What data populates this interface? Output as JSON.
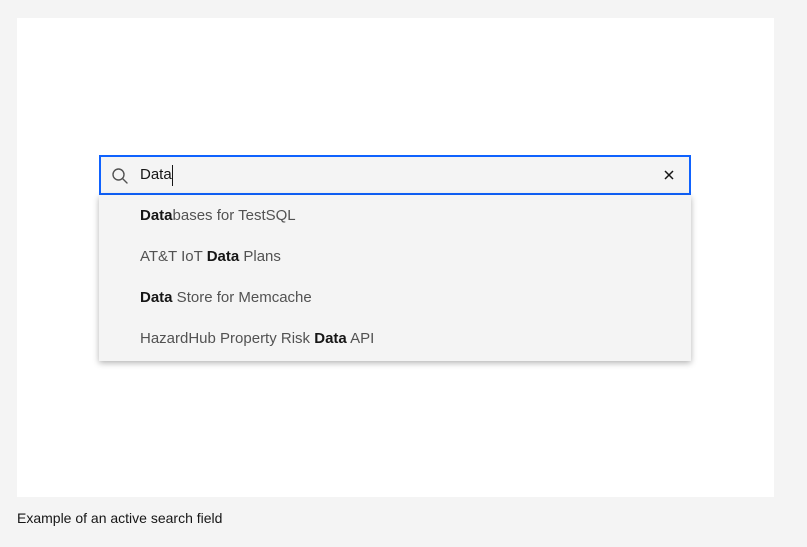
{
  "search": {
    "value": "Data",
    "placeholder": ""
  },
  "suggestions": [
    {
      "pre": "",
      "match": "Data",
      "post": "bases for TestSQL"
    },
    {
      "pre": "AT&T IoT ",
      "match": "Data",
      "post": " Plans"
    },
    {
      "pre": "",
      "match": "Data",
      "post": " Store for Memcache"
    },
    {
      "pre": "HazardHub Property Risk ",
      "match": "Data",
      "post": " API"
    }
  ],
  "caption": "Example of an active search field",
  "colors": {
    "focus_border": "#0f62fe",
    "field_background": "#f4f4f4",
    "text_primary": "#161616",
    "text_secondary": "#525252"
  },
  "icons": {
    "search": "search-icon",
    "clear": "close-icon"
  }
}
